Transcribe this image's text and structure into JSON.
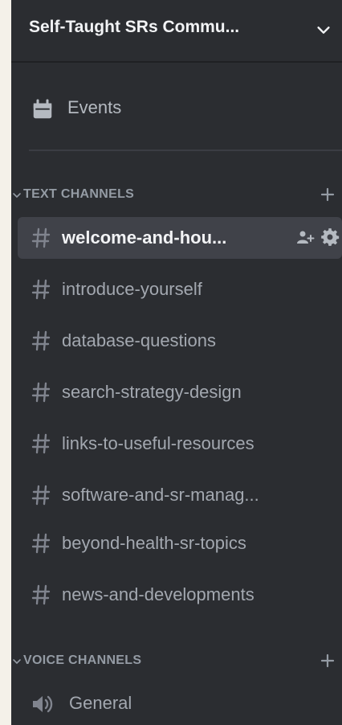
{
  "server": {
    "name": "Self-Taught SRs Commu..."
  },
  "events": {
    "label": "Events"
  },
  "text_category": {
    "label": "TEXT CHANNELS"
  },
  "text_channels": [
    {
      "label": "welcome-and-hou...",
      "active": true
    },
    {
      "label": "introduce-yourself"
    },
    {
      "label": "database-questions"
    },
    {
      "label": "search-strategy-design"
    },
    {
      "label": "links-to-useful-resources"
    },
    {
      "label": "software-and-sr-manag..."
    },
    {
      "label": "beyond-health-sr-topics"
    },
    {
      "label": "news-and-developments"
    }
  ],
  "voice_category": {
    "label": "VOICE CHANNELS"
  },
  "voice_channels": [
    {
      "label": "General"
    }
  ],
  "colors": {
    "sidebar_bg": "#2b2d31",
    "active_bg": "#404249",
    "muted_text": "#a3a8b0",
    "header_text": "#f2f3f5"
  }
}
